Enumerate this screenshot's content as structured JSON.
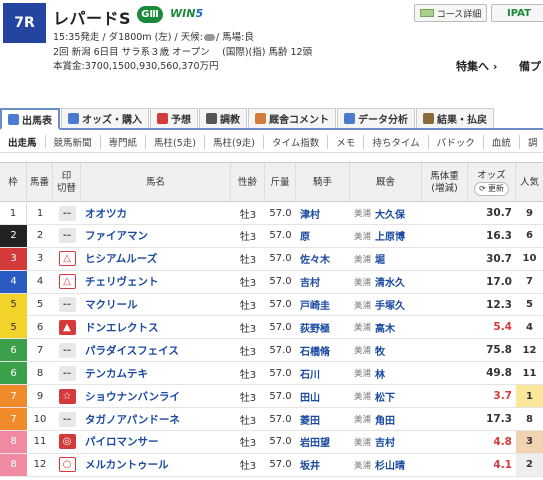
{
  "header": {
    "race_number": "7R",
    "race_name": "レパードS",
    "grade": "GⅢ",
    "win5_a": "WIN",
    "win5_b": "5",
    "course_button": "コース詳細",
    "ipat_button": "IPAT",
    "info_time": "15:35発走 / ダ1800m (左) / 天候:",
    "info_weather_icon": "cloud-icon",
    "info_track": "/ 馬場:良",
    "info_line2": "2回 新潟 6日目 サラ系３歳 オープン　 (国際)(指) 馬齢 12頭",
    "info_line3": "本賞金:3700,1500,930,560,370万円",
    "special_link": "特集へ ›",
    "prep_link": "備プ"
  },
  "tabs": [
    {
      "label": "出馬表",
      "icon": "table-icon",
      "color": "#4a7bd0",
      "active": true
    },
    {
      "label": "オッズ・購入",
      "icon": "chart-icon",
      "color": "#4a7bd0",
      "active": false
    },
    {
      "label": "予想",
      "icon": "target-icon",
      "color": "#d43a3a",
      "active": false
    },
    {
      "label": "調教",
      "icon": "clock-icon",
      "color": "#555555",
      "active": false
    },
    {
      "label": "厩舎コメント",
      "icon": "comment-icon",
      "color": "#d47a3a",
      "active": false
    },
    {
      "label": "データ分析",
      "icon": "data-icon",
      "color": "#4a7bd0",
      "active": false
    },
    {
      "label": "結果・払戻",
      "icon": "result-icon",
      "color": "#8a6a3a",
      "active": false
    }
  ],
  "subtabs": [
    "出走馬",
    "競馬新聞",
    "専門紙",
    "馬柱(5走)",
    "馬柱(9走)",
    "タイム指数",
    "メモ",
    "持ちタイム",
    "パドック",
    "血統",
    "調"
  ],
  "table_headers": {
    "waku": "枠",
    "uma": "馬番",
    "mark": "印",
    "mark_sub": "切替",
    "name": "馬名",
    "sex_age": "性齢",
    "weight": "斤量",
    "jockey": "騎手",
    "trainer": "厩舎",
    "body_weight": "馬体重",
    "body_weight_sub": "(増減)",
    "odds": "オッズ",
    "refresh": "更新",
    "popularity": "人気"
  },
  "waku_colors": {
    "1": {
      "bg": "#ffffff",
      "fg": "#333333"
    },
    "2": {
      "bg": "#222222",
      "fg": "#ffffff"
    },
    "3": {
      "bg": "#d43a3a",
      "fg": "#ffffff"
    },
    "4": {
      "bg": "#2a5bc0",
      "fg": "#ffffff"
    },
    "5": {
      "bg": "#f2d32a",
      "fg": "#333333"
    },
    "6": {
      "bg": "#3aa04a",
      "fg": "#ffffff"
    },
    "7": {
      "bg": "#f08a2a",
      "fg": "#ffffff"
    },
    "8": {
      "bg": "#f08aa0",
      "fg": "#ffffff"
    }
  },
  "rows": [
    {
      "waku": "1",
      "uma": "1",
      "mark": "--",
      "mark_type": "dash",
      "name": "オオツカ",
      "sex_age": "牡3",
      "weight": "57.0",
      "jockey": "津村",
      "aff": "美浦",
      "trainer": "大久保",
      "odds": "30.7",
      "odds_red": false,
      "pop": "9",
      "pop_class": ""
    },
    {
      "waku": "2",
      "uma": "2",
      "mark": "--",
      "mark_type": "dash",
      "name": "ファイアマン",
      "sex_age": "牡3",
      "weight": "57.0",
      "jockey": "原",
      "aff": "美浦",
      "trainer": "上原博",
      "odds": "16.3",
      "odds_red": false,
      "pop": "6",
      "pop_class": ""
    },
    {
      "waku": "3",
      "uma": "3",
      "mark": "△",
      "mark_type": "red",
      "name": "ヒシアムルーズ",
      "sex_age": "牡3",
      "weight": "57.0",
      "jockey": "佐々木",
      "aff": "美浦",
      "trainer": "堀",
      "odds": "30.7",
      "odds_red": false,
      "pop": "10",
      "pop_class": ""
    },
    {
      "waku": "4",
      "uma": "4",
      "mark": "△",
      "mark_type": "red",
      "name": "チェリヴェント",
      "sex_age": "牡3",
      "weight": "57.0",
      "jockey": "吉村",
      "aff": "美浦",
      "trainer": "清水久",
      "odds": "17.0",
      "odds_red": false,
      "pop": "7",
      "pop_class": ""
    },
    {
      "waku": "5",
      "uma": "5",
      "mark": "--",
      "mark_type": "dash",
      "name": "マクリール",
      "sex_age": "牡3",
      "weight": "57.0",
      "jockey": "戸崎圭",
      "aff": "美浦",
      "trainer": "手塚久",
      "odds": "12.3",
      "odds_red": false,
      "pop": "5",
      "pop_class": ""
    },
    {
      "waku": "5",
      "uma": "6",
      "mark": "▲",
      "mark_type": "redf",
      "name": "ドンエレクトス",
      "sex_age": "牡3",
      "weight": "57.0",
      "jockey": "荻野極",
      "aff": "美浦",
      "trainer": "高木",
      "odds": "5.4",
      "odds_red": true,
      "pop": "4",
      "pop_class": ""
    },
    {
      "waku": "6",
      "uma": "7",
      "mark": "--",
      "mark_type": "dash",
      "name": "パラダイスフェイス",
      "sex_age": "牡3",
      "weight": "57.0",
      "jockey": "石橋脩",
      "aff": "美浦",
      "trainer": "牧",
      "odds": "75.8",
      "odds_red": false,
      "pop": "12",
      "pop_class": ""
    },
    {
      "waku": "6",
      "uma": "8",
      "mark": "--",
      "mark_type": "dash",
      "name": "テンカムテキ",
      "sex_age": "牡3",
      "weight": "57.0",
      "jockey": "石川",
      "aff": "美浦",
      "trainer": "林",
      "odds": "49.8",
      "odds_red": false,
      "pop": "11",
      "pop_class": ""
    },
    {
      "waku": "7",
      "uma": "9",
      "mark": "☆",
      "mark_type": "redf",
      "name": "ショウナンバンライ",
      "sex_age": "牡3",
      "weight": "57.0",
      "jockey": "田山",
      "aff": "美浦",
      "trainer": "松下",
      "odds": "3.7",
      "odds_red": true,
      "pop": "1",
      "pop_class": "pop1"
    },
    {
      "waku": "7",
      "uma": "10",
      "mark": "--",
      "mark_type": "dash",
      "name": "タガノアパンドーネ",
      "sex_age": "牡3",
      "weight": "57.0",
      "jockey": "菱田",
      "aff": "美浦",
      "trainer": "角田",
      "odds": "17.3",
      "odds_red": false,
      "pop": "8",
      "pop_class": ""
    },
    {
      "waku": "8",
      "uma": "11",
      "mark": "◎",
      "mark_type": "redf",
      "name": "パイロマンサー",
      "sex_age": "牡3",
      "weight": "57.0",
      "jockey": "岩田望",
      "aff": "美浦",
      "trainer": "吉村",
      "odds": "4.8",
      "odds_red": true,
      "pop": "3",
      "pop_class": "pop3"
    },
    {
      "waku": "8",
      "uma": "12",
      "mark": "○",
      "mark_type": "red",
      "name": "メルカントゥール",
      "sex_age": "牡3",
      "weight": "57.0",
      "jockey": "坂井",
      "aff": "美浦",
      "trainer": "杉山晴",
      "odds": "4.1",
      "odds_red": true,
      "pop": "2",
      "pop_class": "pop2"
    }
  ]
}
